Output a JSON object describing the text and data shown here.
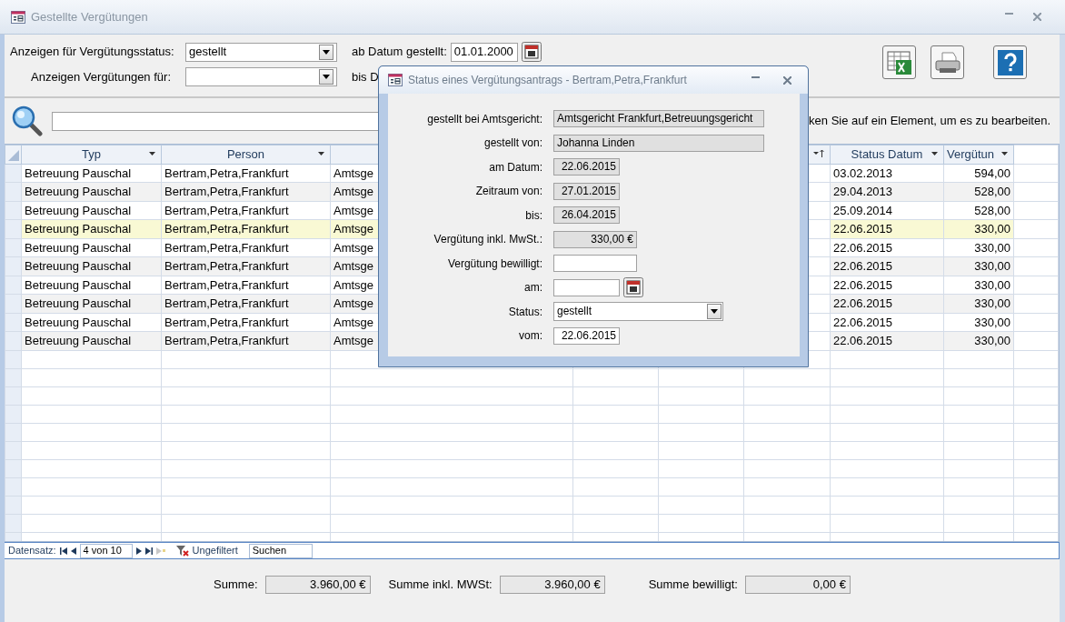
{
  "window": {
    "title": "Gestellte Vergütungen"
  },
  "filters": {
    "status_label": "Anzeigen für Vergütungsstatus:",
    "status_value": "gestellt",
    "for_label": "Anzeigen Vergütungen für:",
    "from_label": "ab Datum gestellt:",
    "from_value": "01.01.2000",
    "to_label": "bis D"
  },
  "search": {
    "hint": "ken Sie auf ein Element, um es zu bearbeiten."
  },
  "table": {
    "columns": [
      "Typ",
      "Person",
      "Status Datum",
      "Vergütun"
    ],
    "rows": [
      {
        "typ": "Betreuung Pauschal",
        "person": "Bertram,Petra,Frankfurt",
        "column_3": "Amtsge",
        "status_datum": "03.02.2013",
        "verguetung": "594,00",
        "selected": false
      },
      {
        "typ": "Betreuung Pauschal",
        "person": "Bertram,Petra,Frankfurt",
        "column_3": "Amtsge",
        "status_datum": "29.04.2013",
        "verguetung": "528,00",
        "selected": false
      },
      {
        "typ": "Betreuung Pauschal",
        "person": "Bertram,Petra,Frankfurt",
        "column_3": "Amtsge",
        "status_datum": "25.09.2014",
        "verguetung": "528,00",
        "selected": false
      },
      {
        "typ": "Betreuung Pauschal",
        "person": "Bertram,Petra,Frankfurt",
        "column_3": "Amtsge",
        "status_datum": "22.06.2015",
        "verguetung": "330,00",
        "selected": true
      },
      {
        "typ": "Betreuung Pauschal",
        "person": "Bertram,Petra,Frankfurt",
        "column_3": "Amtsge",
        "status_datum": "22.06.2015",
        "verguetung": "330,00",
        "selected": false
      },
      {
        "typ": "Betreuung Pauschal",
        "person": "Bertram,Petra,Frankfurt",
        "column_3": "Amtsge",
        "status_datum": "22.06.2015",
        "verguetung": "330,00",
        "selected": false
      },
      {
        "typ": "Betreuung Pauschal",
        "person": "Bertram,Petra,Frankfurt",
        "column_3": "Amtsge",
        "status_datum": "22.06.2015",
        "verguetung": "330,00",
        "selected": false
      },
      {
        "typ": "Betreuung Pauschal",
        "person": "Bertram,Petra,Frankfurt",
        "column_3": "Amtsge",
        "status_datum": "22.06.2015",
        "verguetung": "330,00",
        "selected": false
      },
      {
        "typ": "Betreuung Pauschal",
        "person": "Bertram,Petra,Frankfurt",
        "column_3": "Amtsge",
        "status_datum": "22.06.2015",
        "verguetung": "330,00",
        "selected": false
      },
      {
        "typ": "Betreuung Pauschal",
        "person": "Bertram,Petra,Frankfurt",
        "column_3": "Amtsge",
        "status_datum": "22.06.2015",
        "verguetung": "330,00",
        "selected": false
      }
    ]
  },
  "record_nav": {
    "label": "Datensatz:",
    "position": "4 von 10",
    "filter": "Ungefiltert",
    "search": "Suchen"
  },
  "totals": [
    {
      "label": "Summe:",
      "value": "3.960,00 €"
    },
    {
      "label": "Summe inkl. MWSt:",
      "value": "3.960,00 €"
    },
    {
      "label": "Summe bewilligt:",
      "value": "0,00 €"
    }
  ],
  "dialog": {
    "title": "Status eines Vergütungsantrags - Bertram,Petra,Frankfurt",
    "fields": [
      {
        "label": "gestellt bei Amtsgericht:",
        "value": "Amtsgericht Frankfurt,Betreuungsgericht",
        "kind": "text"
      },
      {
        "label": "gestellt von:",
        "value": "Johanna Linden",
        "kind": "text"
      },
      {
        "label": "am Datum:",
        "value": "22.06.2015",
        "kind": "date"
      },
      {
        "label": "Zeitraum von:",
        "value": "27.01.2015",
        "kind": "date"
      },
      {
        "label": "bis:",
        "value": "26.04.2015",
        "kind": "date"
      },
      {
        "label": "Vergütung inkl. MwSt.:",
        "value": "330,00 €",
        "kind": "amount"
      },
      {
        "label": "Vergütung bewilligt:",
        "kind": "entry"
      },
      {
        "label": "am:",
        "kind": "picker"
      },
      {
        "label": "Status:",
        "value": "gestellt",
        "kind": "choice"
      },
      {
        "label": "vom:",
        "value": "22.06.2015",
        "kind": "dateentry"
      }
    ]
  }
}
